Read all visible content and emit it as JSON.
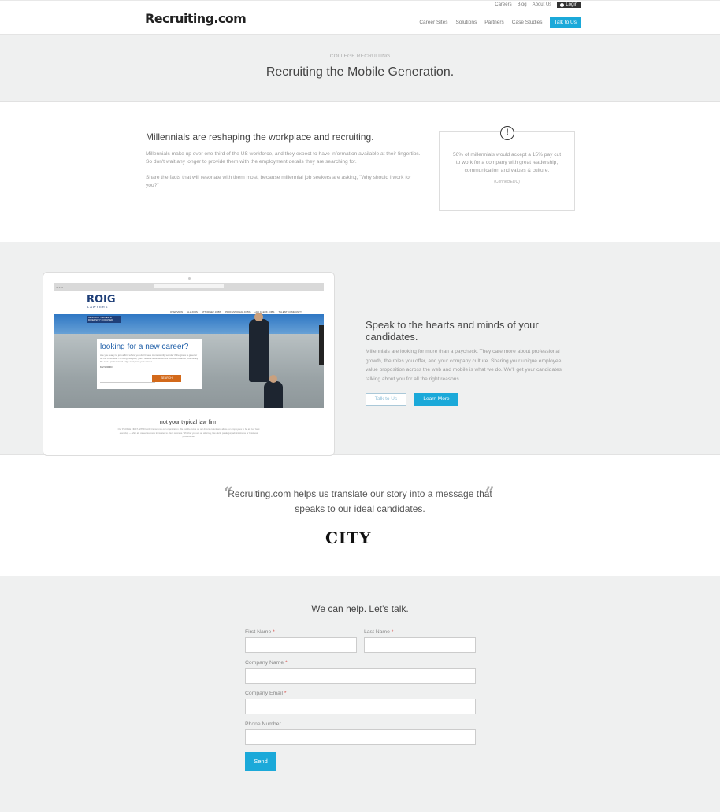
{
  "header": {
    "logo": "Recruiting.com",
    "util_links": [
      "Careers",
      "Blog",
      "About Us"
    ],
    "login_label": "Login",
    "nav_items": [
      "Career Sites",
      "Solutions",
      "Partners",
      "Case Studies"
    ],
    "nav_cta": "Talk to Us"
  },
  "hero": {
    "eyebrow": "COLLEGE RECRUITING",
    "title": "Recruiting the Mobile Generation."
  },
  "millennials": {
    "heading": "Millennials are reshaping the workplace and recruiting.",
    "paragraph1": "Millennials make up over one-third of the US workforce, and they expect to have information available at their fingertips. So don't wait any longer to provide them with the employment details they are searching for.",
    "paragraph2": "Share the facts that will resonate with them most, because millennial job seekers are asking, \"Why should I work for you?\"",
    "stat_icon": "!",
    "stat_text": "56% of millennials would accept a 15% pay cut to work for a company with great leadership, communication and values & culture.",
    "stat_source": "(ConnectEDU)"
  },
  "device_screen": {
    "logo": "ROIG",
    "logo_sub": "LAWYERS",
    "tag": "MINORITY OWNED & DIVERSITY FOCUSED",
    "nav": [
      "OVERVIEW",
      "ALL JOBS",
      "ATTORNEY JOBS",
      "PROFESSIONAL JOBS",
      "LAW CLERK JOBS",
      "TALENT COMMUNITY"
    ],
    "career_title": "looking for a new career?",
    "career_desc": "Are you ready to join a firm where you don't have to constantly wonder if the grass is greener on the other side? At Roig Lawyers, you'll receive a career where you can balance your family life and a professional edge and grow your career.",
    "keyword_label": "KEYWORD",
    "search_label": "SEARCH",
    "tagline_pre": "not your ",
    "tagline_underlined": "typical",
    "tagline_post": " law firm",
    "body": "Our PEOPLE FIRST APPROACH transcends our organization. We put the focus on our diverse talent and allow our employees to be at their best everyday — after all, career success translates to client success. Whether you are an attorney, law clerk, paralegal, administrative or business professional."
  },
  "hearts": {
    "heading": "Speak to the hearts and minds of your candidates.",
    "paragraph": "Millennials are looking for more than a paycheck. They care more about professional growth, the roles you offer, and your company culture. Sharing your unique employee value proposition across the web and mobile is what we do. We'll get your candidates talking about you for all the right reasons.",
    "btn_talk": "Talk to Us",
    "btn_learn": "Learn More"
  },
  "testimonial": {
    "quote": "Recruiting.com helps us translate our story into a message that speaks to our ideal candidates.",
    "open_mark": "“",
    "close_mark": "”",
    "client_logo": "CITY"
  },
  "contact": {
    "heading": "We can help. Let's talk.",
    "first_name_label": "First Name",
    "last_name_label": "Last Name",
    "company_name_label": "Company Name",
    "company_email_label": "Company Email",
    "phone_label": "Phone Number",
    "required_mark": "*",
    "send_label": "Send"
  }
}
